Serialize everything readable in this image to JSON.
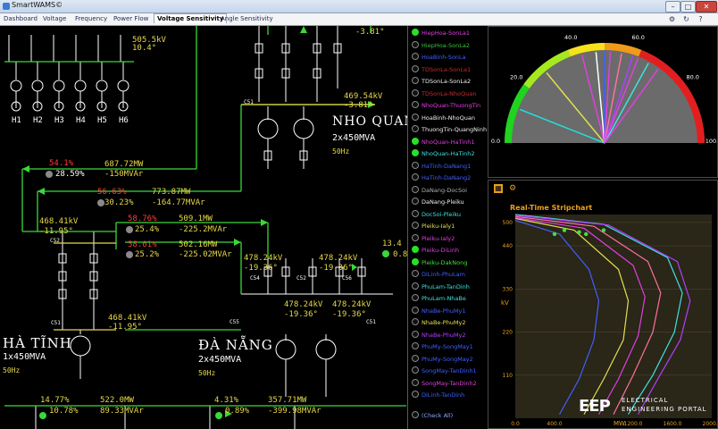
{
  "window": {
    "title": "SmartWAMS©"
  },
  "tabs": [
    "Dashboard",
    "Voltage",
    "Frequency",
    "Power Flow",
    "Voltage Sensitivity",
    "Angle Sensitivity"
  ],
  "active_tab": "Voltage Sensitivity",
  "diagram": {
    "generators": [
      "H1",
      "H2",
      "H3",
      "H4",
      "H5",
      "H6"
    ],
    "top_reading": {
      "kv": "505.5kV",
      "deg": "10.4°"
    },
    "top_center_deg": "-3.81°",
    "nho_quan": {
      "kv": "469.54kV",
      "deg": "-3.81°",
      "name": "NHO QUAN",
      "spec": "2x450MVA",
      "hz": "50Hz",
      "breaker": "C51"
    },
    "flow1": {
      "pct1": "54.1%",
      "pct2": "28.59%",
      "mw": "687.72MW",
      "mvar": "-150MVAr"
    },
    "flow2": {
      "pct1": "56.63%",
      "pct2": "30.23%",
      "mw": "773.87MW",
      "mvar": "-164.77MVAr"
    },
    "ha_tinh_top": {
      "kv": "468.41kV",
      "deg": "-11.95°"
    },
    "flow3": {
      "pct1": "58.76%",
      "pct2": "25.4%",
      "mw": "509.1MW",
      "mvar": "-225.2MVAr"
    },
    "flow4": {
      "pct1": "58.61%",
      "pct2": "25.2%",
      "mw": "502.16MW",
      "mvar": "-225.02MVAr"
    },
    "ha_tinh_low": {
      "kv": "468.41kV",
      "deg": "-11.95°",
      "name": "HÀ TĨNH",
      "spec": "1x450MVA",
      "hz": "50Hz"
    },
    "da_nang": {
      "name": "ĐÀ NẴNG",
      "spec": "2x450MVA",
      "hz": "50Hz"
    },
    "dn_readings": [
      {
        "kv": "478.24kV",
        "deg": "-19.36°"
      },
      {
        "kv": "478.24kV",
        "deg": "-19.36°"
      },
      {
        "kv": "478.24kV",
        "deg": "-19.36°"
      },
      {
        "kv": "478.24kV",
        "deg": "-19.36°"
      }
    ],
    "right_edge": {
      "val": "13.4",
      "pct": "0.8"
    },
    "breakers": [
      "C52",
      "C51",
      "C54",
      "C52",
      "C56",
      "C55",
      "C51"
    ],
    "bottom_flows": [
      {
        "pct1": "14.77%",
        "pct2": "10.78%",
        "mw": "522.0MW",
        "mvar": "89.33MVAr"
      },
      {
        "pct1": "4.31%",
        "pct2": "0.89%",
        "mw": "357.71MW",
        "mvar": "-399.98MVAr"
      }
    ]
  },
  "lines_list": {
    "items": [
      {
        "label": "HiepHoa-SonLa1",
        "color": "#e040e0",
        "checked": true
      },
      {
        "label": "HiepHoa-SonLa2",
        "color": "#40c040",
        "checked": false
      },
      {
        "label": "HoaBinh-SonLa",
        "color": "#4060ff",
        "checked": false
      },
      {
        "label": "TDSonLa-SonLa1",
        "color": "#c03030",
        "checked": false
      },
      {
        "label": "TDSonLa-SonLa2",
        "color": "#f0f0f0",
        "checked": false
      },
      {
        "label": "TDSonLa-NhoQuan",
        "color": "#c03030",
        "checked": false
      },
      {
        "label": "NhoQuan-ThuongTin",
        "color": "#e040e0",
        "checked": false
      },
      {
        "label": "HoaBinh-NhoQuan",
        "color": "#f0f0f0",
        "checked": false
      },
      {
        "label": "ThuongTin-QuangNinh",
        "color": "#f0f0f0",
        "checked": false
      },
      {
        "label": "NhoQuan-HaTinh1",
        "color": "#e040e0",
        "checked": true
      },
      {
        "label": "NhoQuan-HaTinh2",
        "color": "#40e0e0",
        "checked": true
      },
      {
        "label": "HaTinh-DaNang1",
        "color": "#4060ff",
        "checked": false
      },
      {
        "label": "HaTinh-DaNang2",
        "color": "#4060ff",
        "checked": false
      },
      {
        "label": "DaNang-DocSoi",
        "color": "#b0b0b0",
        "checked": false
      },
      {
        "label": "DaNang-Pleiku",
        "color": "#f0f0f0",
        "checked": false
      },
      {
        "label": "DocSoi-Pleiku",
        "color": "#40e0e0",
        "checked": false
      },
      {
        "label": "Pleiku-Ialy1",
        "color": "#e0e050",
        "checked": false
      },
      {
        "label": "Pleiku-Ialy2",
        "color": "#e040e0",
        "checked": false
      },
      {
        "label": "Pleiku-DiLinh",
        "color": "#e040e0",
        "checked": true
      },
      {
        "label": "Pleiku-DakNong",
        "color": "#40e040",
        "checked": true
      },
      {
        "label": "DiLinh-PhuLam",
        "color": "#4060ff",
        "checked": false
      },
      {
        "label": "PhuLam-TanDinh",
        "color": "#40e0e0",
        "checked": false
      },
      {
        "label": "PhuLam-NhaBe",
        "color": "#40e0e0",
        "checked": false
      },
      {
        "label": "NhaBe-PhuMy1",
        "color": "#4060ff",
        "checked": false
      },
      {
        "label": "NhaBe-PhuMy2",
        "color": "#e0e050",
        "checked": false
      },
      {
        "label": "NhaBe-PhuMy2",
        "color": "#b040ff",
        "checked": false
      },
      {
        "label": "PhuMy-SongMay1",
        "color": "#4060ff",
        "checked": false
      },
      {
        "label": "PhuMy-SongMay2",
        "color": "#4060ff",
        "checked": false
      },
      {
        "label": "SongMay-TanDinh1",
        "color": "#4060ff",
        "checked": false
      },
      {
        "label": "SongMay-TanDinh2",
        "color": "#e040e0",
        "checked": false
      },
      {
        "label": "DiLinh-TanDinh",
        "color": "#4060ff",
        "checked": false
      }
    ],
    "check_all": "(Check All)"
  },
  "gauge": {
    "ticks": [
      "0.0",
      "20.0",
      "40.0",
      "60.0",
      "80.0",
      "100.0"
    ]
  },
  "stripchart": {
    "title": "Real-Time Stripchart",
    "y_label": "kV",
    "x_label": "MW",
    "y_ticks": [
      "500",
      "440",
      "330",
      "220",
      "110"
    ],
    "x_ticks": [
      "0.0",
      "400.0",
      "1200.0",
      "1600.0",
      "2000.0"
    ],
    "ylim": [
      0,
      520
    ],
    "xlim": [
      0,
      2000
    ]
  },
  "watermark": {
    "logo": "EEP",
    "text1": "ELECTRICAL",
    "text2": "ENGINEERING PORTAL"
  }
}
